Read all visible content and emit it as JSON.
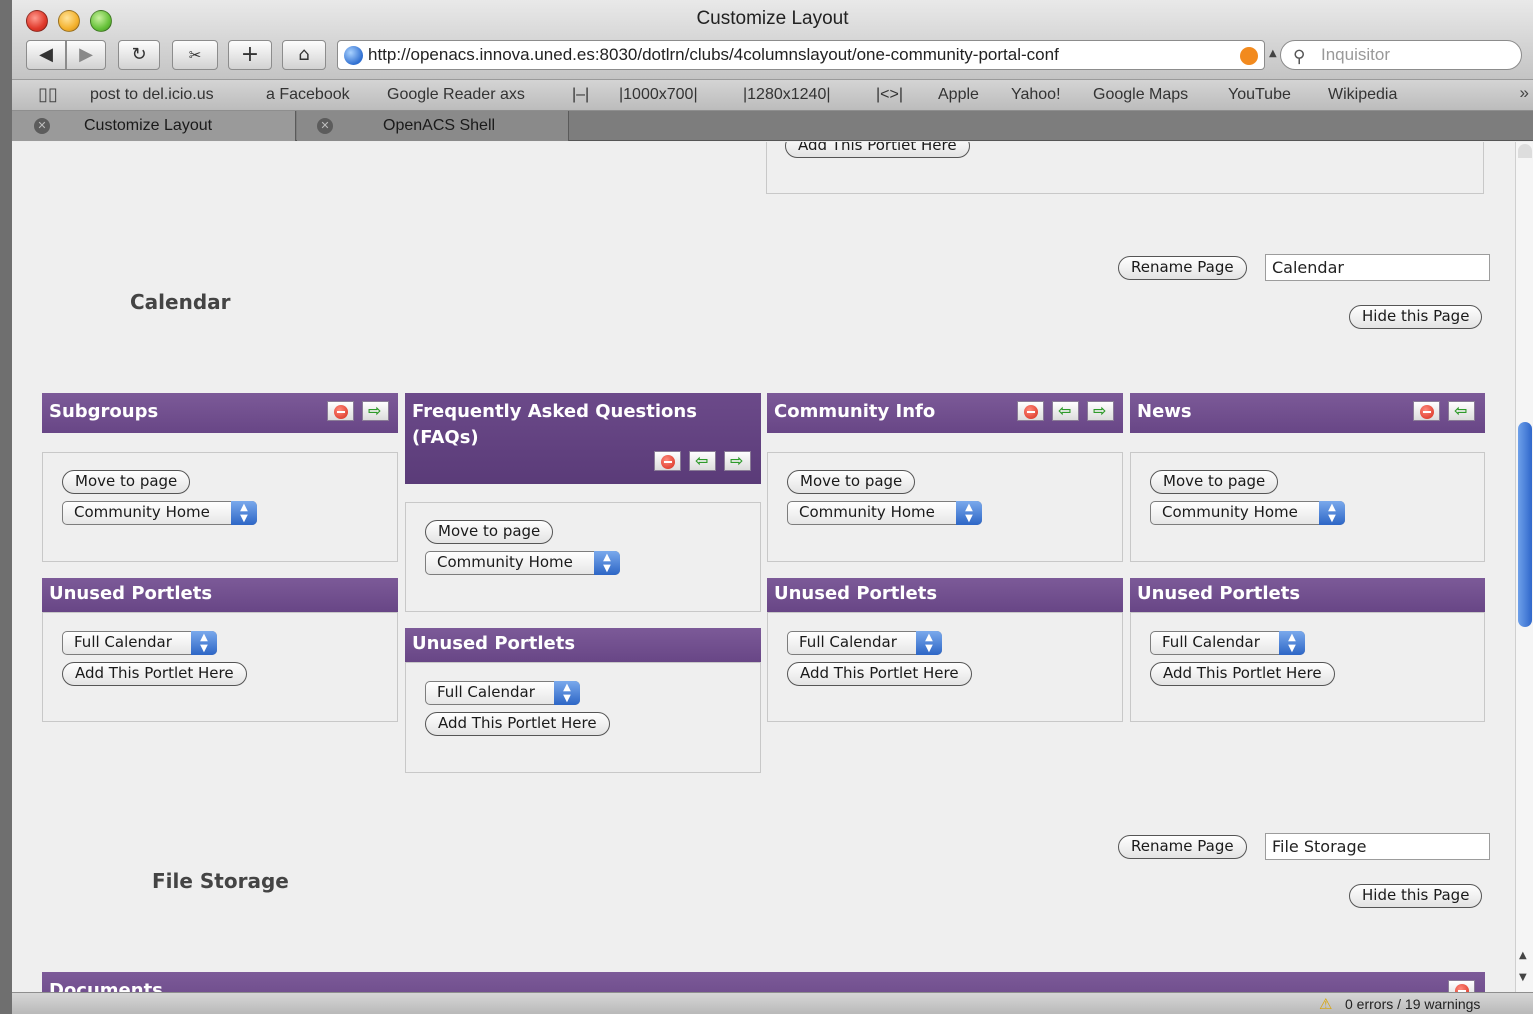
{
  "window": {
    "title": "Customize Layout"
  },
  "toolbar": {
    "url": "http://openacs.innova.uned.es:8030/dotlrn/clubs/4columnslayout/one-community-portal-conf",
    "search_placeholder": "Inquisitor"
  },
  "bookmarks": [
    "post to del.icio.us",
    "a Facebook",
    "Google Reader axs",
    "|–|",
    "|1000x700|",
    "|1280x1240|",
    "|<>|",
    "Apple",
    "Yahoo!",
    "Google Maps",
    "YouTube",
    "Wikipedia"
  ],
  "tabs": [
    {
      "label": "Customize Layout"
    },
    {
      "label": "OpenACS Shell"
    }
  ],
  "top_partial": {
    "add_button": "Add This Portlet Here"
  },
  "calendar_page": {
    "title": "Calendar",
    "rename_button": "Rename Page",
    "name_value": "Calendar",
    "hide_button": "Hide this Page",
    "columns": [
      {
        "portlet": "Subgroups",
        "move_button": "Move to page",
        "page_select": "Community Home",
        "unused_title": "Unused Portlets",
        "unused_select": "Full Calendar",
        "add_button": "Add This Portlet Here"
      },
      {
        "portlet": "Frequently Asked Questions (FAQs)",
        "move_button": "Move to page",
        "page_select": "Community Home",
        "unused_title": "Unused Portlets",
        "unused_select": "Full Calendar",
        "add_button": "Add This Portlet Here"
      },
      {
        "portlet": "Community Info",
        "move_button": "Move to page",
        "page_select": "Community Home",
        "unused_title": "Unused Portlets",
        "unused_select": "Full Calendar",
        "add_button": "Add This Portlet Here"
      },
      {
        "portlet": "News",
        "move_button": "Move to page",
        "page_select": "Community Home",
        "unused_title": "Unused Portlets",
        "unused_select": "Full Calendar",
        "add_button": "Add This Portlet Here"
      }
    ]
  },
  "file_storage_page": {
    "title": "File Storage",
    "rename_button": "Rename Page",
    "name_value": "File Storage",
    "hide_button": "Hide this Page",
    "portlet": "Documents"
  },
  "statusbar": {
    "text": "0 errors / 19 warnings"
  }
}
